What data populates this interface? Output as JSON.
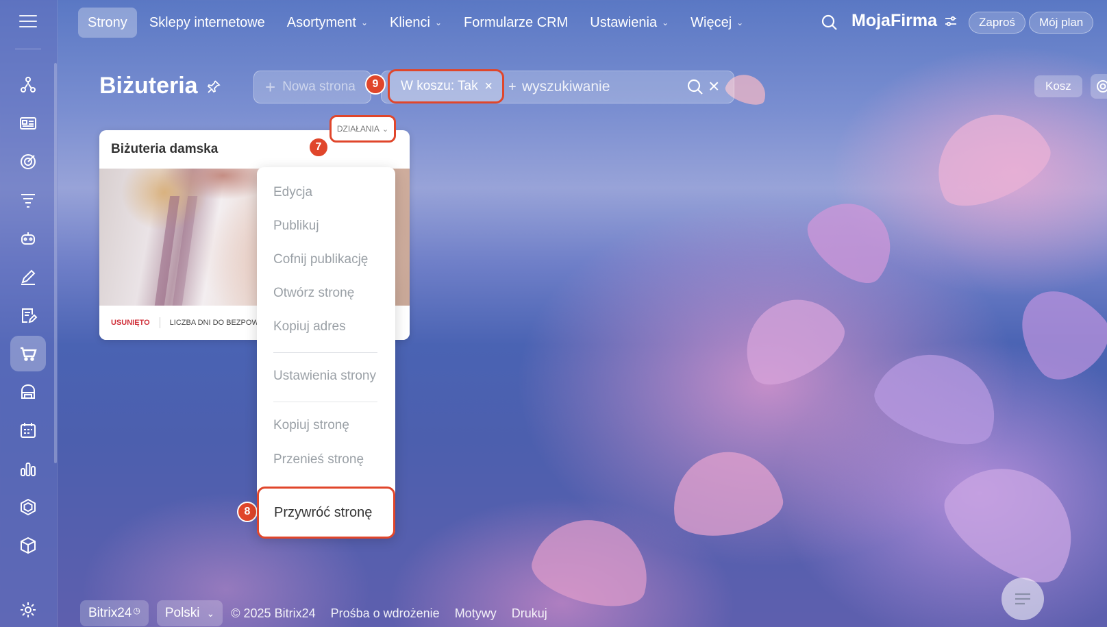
{
  "nav": {
    "items": [
      {
        "label": "Strony",
        "active": true,
        "has_dropdown": false
      },
      {
        "label": "Sklepy internetowe",
        "active": false,
        "has_dropdown": false
      },
      {
        "label": "Asortyment",
        "active": false,
        "has_dropdown": true
      },
      {
        "label": "Klienci",
        "active": false,
        "has_dropdown": true
      },
      {
        "label": "Formularze CRM",
        "active": false,
        "has_dropdown": false
      },
      {
        "label": "Ustawienia",
        "active": false,
        "has_dropdown": true
      },
      {
        "label": "Więcej",
        "active": false,
        "has_dropdown": true
      }
    ],
    "brand": "MojaFirma",
    "invite_label": "Zaproś",
    "plan_label": "Mój plan"
  },
  "sidebar": {
    "icons": [
      "routes-icon",
      "cards-icon",
      "target-icon",
      "funnel-icon",
      "robot-icon",
      "pen-icon",
      "document-edit-icon",
      "cart-icon",
      "store-icon",
      "calendar-icon",
      "chart-icon",
      "hexagon-icon",
      "box-icon",
      "gear-icon"
    ],
    "active_index": 7
  },
  "page": {
    "title": "Biżuteria",
    "new_page_label": "Nowa strona",
    "filter_chip": "W koszu: Tak",
    "search_placeholder": "wyszukiwanie",
    "search_plus": "+",
    "trash_label": "Kosz"
  },
  "badges": {
    "actions": "7",
    "restore": "8",
    "filter": "9"
  },
  "card": {
    "title": "Biżuteria damska",
    "actions_label": "DZIAŁANIA",
    "deleted_label": "USUNIĘTO",
    "days_label": "LICZBA DNI DO BEZPOWROTNEGO USUNIĘCIA"
  },
  "menu": {
    "items": [
      "Edycja",
      "Publikuj",
      "Cofnij publikację",
      "Otwórz stronę",
      "Kopiuj adres",
      "Ustawienia strony",
      "Kopiuj stronę",
      "Przenieś stronę"
    ],
    "restore_label": "Przywróć stronę"
  },
  "footer": {
    "brand_label": "Bitrix24",
    "language_label": "Polski",
    "copyright": "© 2025 Bitrix24",
    "links": [
      "Prośba o wdrożenie",
      "Motywy",
      "Drukuj"
    ]
  },
  "colors": {
    "accent": "#e0462b",
    "deleted": "#d0303a",
    "menu_disabled": "#9aa0a6"
  }
}
